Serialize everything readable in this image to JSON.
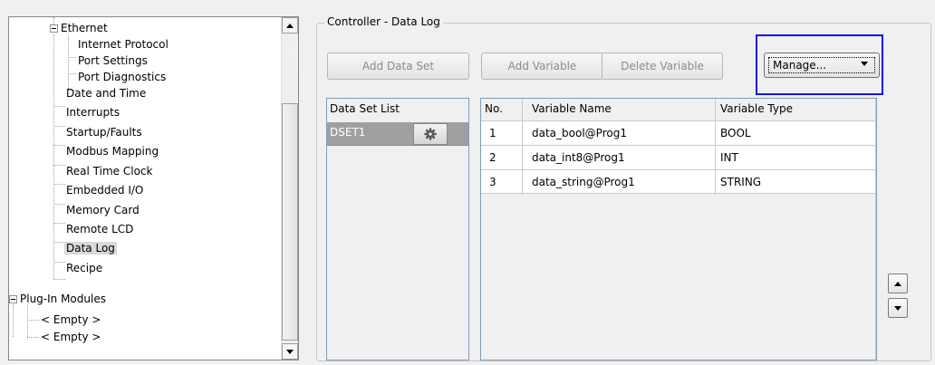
{
  "tree": {
    "items": [
      {
        "label": "Ethernet",
        "expanded": true
      },
      {
        "label": "Internet Protocol"
      },
      {
        "label": "Port Settings"
      },
      {
        "label": "Port Diagnostics"
      },
      {
        "label": "Date and Time"
      },
      {
        "label": "Interrupts"
      },
      {
        "label": "Startup/Faults"
      },
      {
        "label": "Modbus Mapping"
      },
      {
        "label": "Real Time Clock"
      },
      {
        "label": "Embedded I/O"
      },
      {
        "label": "Memory Card"
      },
      {
        "label": "Remote LCD"
      },
      {
        "label": "Data Log",
        "selected": true
      },
      {
        "label": "Recipe"
      },
      {
        "label": "Plug-In Modules",
        "expanded": true
      },
      {
        "label": "< Empty >"
      },
      {
        "label": "< Empty >"
      }
    ]
  },
  "group": {
    "title": "Controller - Data Log"
  },
  "toolbar": {
    "add_data_set": "Add Data Set",
    "add_variable": "Add Variable",
    "delete_variable": "Delete Variable",
    "manage": "Manage..."
  },
  "dataset_list": {
    "header": "Data Set List",
    "items": [
      {
        "name": "DSET1"
      }
    ]
  },
  "variables": {
    "headers": {
      "no": "No.",
      "name": "Variable Name",
      "type": "Variable Type"
    },
    "rows": [
      {
        "no": "1",
        "name": "data_bool@Prog1",
        "type": "BOOL"
      },
      {
        "no": "2",
        "name": "data_int8@Prog1",
        "type": "INT"
      },
      {
        "no": "3",
        "name": "data_string@Prog1",
        "type": "STRING"
      }
    ]
  },
  "colors": {
    "focus_border": "#1414e6",
    "selected_dataset_row": "#a0a0a0"
  },
  "icons": {
    "dataset_settings": "gear-icon",
    "move_up": "arrow-up-icon",
    "move_down": "arrow-down-icon"
  }
}
